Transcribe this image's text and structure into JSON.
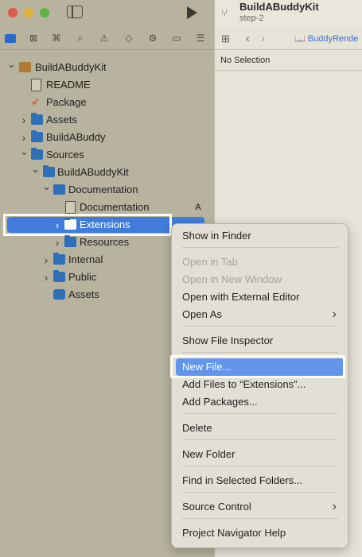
{
  "navigator": {
    "tree": [
      {
        "label": "BuildABuddyKit",
        "icon": "package-icon",
        "chevron": "down"
      },
      {
        "label": "README",
        "icon": "document-icon"
      },
      {
        "label": "Package",
        "icon": "swift-icon"
      },
      {
        "label": "Assets",
        "icon": "folder-icon",
        "chevron": "right"
      },
      {
        "label": "BuildABuddy",
        "icon": "folder-icon",
        "chevron": "right"
      },
      {
        "label": "Sources",
        "icon": "folder-icon",
        "chevron": "down"
      },
      {
        "label": "BuildABuddyKit",
        "icon": "folder-icon",
        "chevron": "down"
      },
      {
        "label": "Documentation",
        "icon": "docc-catalog-icon",
        "chevron": "down"
      },
      {
        "label": "Documentation",
        "icon": "document-icon",
        "badge": "A"
      },
      {
        "label": "Extensions",
        "icon": "folder-icon",
        "chevron": "right",
        "selected": true
      },
      {
        "label": "Resources",
        "icon": "folder-icon",
        "chevron": "right"
      },
      {
        "label": "Internal",
        "icon": "folder-icon",
        "chevron": "right"
      },
      {
        "label": "Public",
        "icon": "folder-icon",
        "chevron": "right"
      },
      {
        "label": "Assets",
        "icon": "asset-catalog-icon"
      }
    ]
  },
  "editor": {
    "project_title": "BuildABuddyKit",
    "project_subtitle": "step-2",
    "jump_file": "BuddyRende",
    "no_selection": "No Selection"
  },
  "context_menu": {
    "items": [
      {
        "label": "Show in Finder",
        "enabled": true
      },
      {
        "label": "Open in Tab",
        "enabled": false
      },
      {
        "label": "Open in New Window",
        "enabled": false
      },
      {
        "label": "Open with External Editor",
        "enabled": true
      },
      {
        "label": "Open As",
        "enabled": true,
        "submenu": true
      },
      {
        "label": "Show File Inspector",
        "enabled": true
      },
      {
        "label": "New File...",
        "enabled": true,
        "highlighted": true
      },
      {
        "label": "Add Files to “Extensions”...",
        "enabled": true
      },
      {
        "label": "Add Packages...",
        "enabled": true
      },
      {
        "label": "Delete",
        "enabled": true
      },
      {
        "label": "New Folder",
        "enabled": true
      },
      {
        "label": "Find in Selected Folders...",
        "enabled": true
      },
      {
        "label": "Source Control",
        "enabled": true,
        "submenu": true
      },
      {
        "label": "Project Navigator Help",
        "enabled": true
      }
    ]
  },
  "colors": {
    "selection": "#3f7cdc",
    "menu_highlight": "#6395ea",
    "folder": "#2f6fb8"
  }
}
